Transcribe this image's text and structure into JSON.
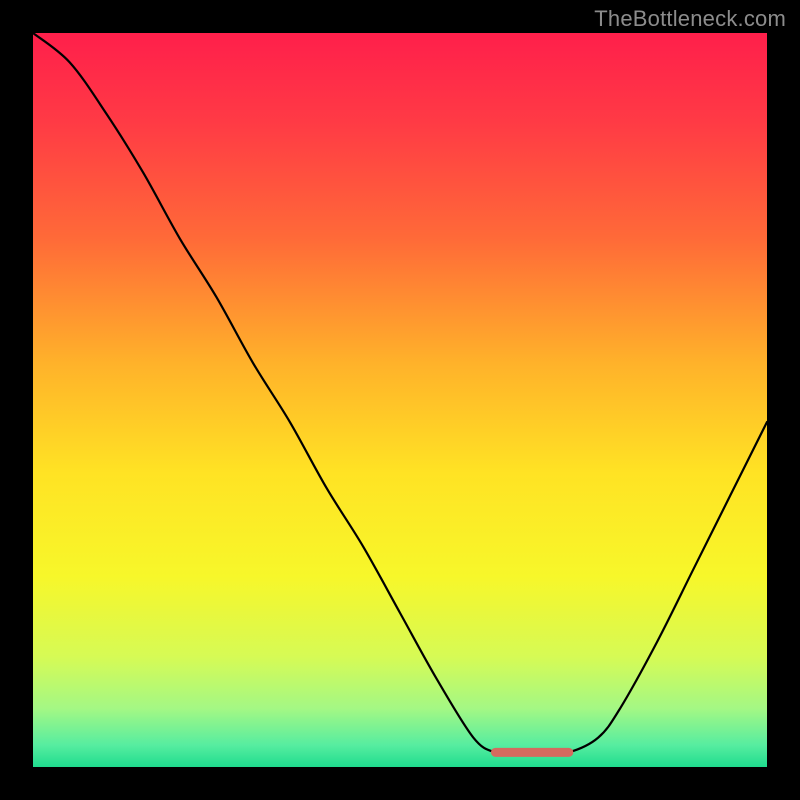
{
  "watermark": {
    "text": "TheBottleneck.com"
  },
  "chart_data": {
    "type": "line",
    "title": "",
    "xlabel": "",
    "ylabel": "",
    "xlim": [
      0,
      1
    ],
    "ylim": [
      0,
      1
    ],
    "series": [
      {
        "name": "curve",
        "color": "#000000",
        "x": [
          0.0,
          0.05,
          0.1,
          0.15,
          0.2,
          0.25,
          0.3,
          0.35,
          0.4,
          0.45,
          0.5,
          0.55,
          0.6,
          0.63,
          0.66,
          0.7,
          0.73,
          0.77,
          0.8,
          0.85,
          0.9,
          0.95,
          1.0
        ],
        "y": [
          1.0,
          0.96,
          0.89,
          0.81,
          0.72,
          0.64,
          0.55,
          0.47,
          0.38,
          0.3,
          0.21,
          0.12,
          0.04,
          0.02,
          0.02,
          0.02,
          0.02,
          0.04,
          0.08,
          0.17,
          0.27,
          0.37,
          0.47
        ]
      },
      {
        "name": "highlight-segment",
        "color": "#d46a5f",
        "x": [
          0.63,
          0.66,
          0.7,
          0.73
        ],
        "y": [
          0.02,
          0.02,
          0.02,
          0.02
        ]
      }
    ],
    "background_gradient": {
      "stops": [
        {
          "offset": 0.0,
          "color": "#ff1f4b"
        },
        {
          "offset": 0.12,
          "color": "#ff3a45"
        },
        {
          "offset": 0.28,
          "color": "#ff6a38"
        },
        {
          "offset": 0.45,
          "color": "#ffb22a"
        },
        {
          "offset": 0.6,
          "color": "#ffe324"
        },
        {
          "offset": 0.74,
          "color": "#f7f72a"
        },
        {
          "offset": 0.85,
          "color": "#d6fa55"
        },
        {
          "offset": 0.92,
          "color": "#a4f884"
        },
        {
          "offset": 0.97,
          "color": "#57eda0"
        },
        {
          "offset": 1.0,
          "color": "#1fdc8e"
        }
      ]
    }
  }
}
